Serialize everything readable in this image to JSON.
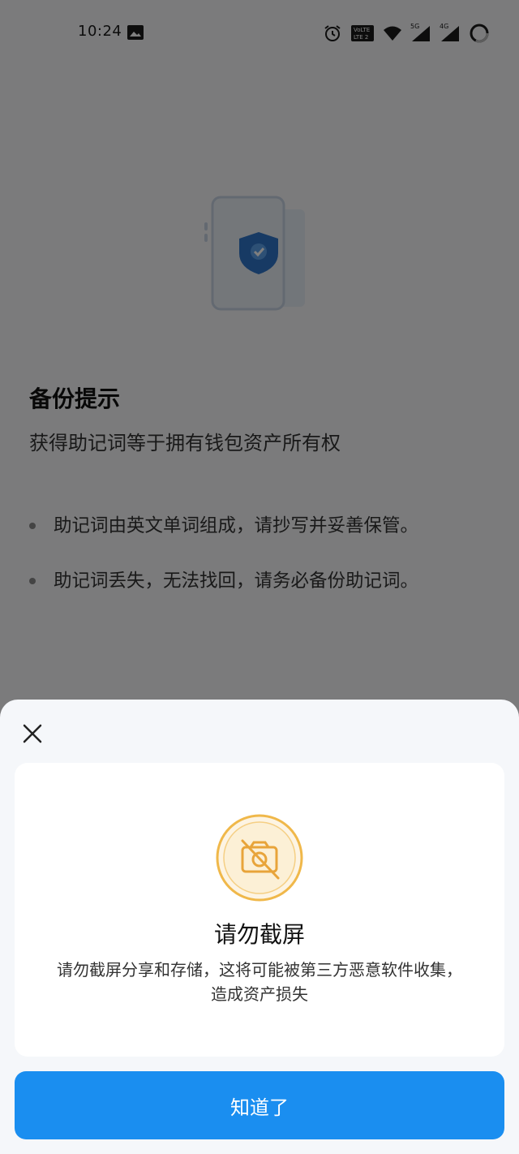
{
  "status_bar": {
    "time": "10:24",
    "icons": [
      "image-icon",
      "alarm-icon",
      "volte-lte-icon",
      "wifi-icon",
      "5g-signal-icon",
      "4g-signal-icon",
      "battery-icon"
    ],
    "network_5g": "5G",
    "network_4g": "4G"
  },
  "page": {
    "title": "备份提示",
    "subtitle": "获得助记词等于拥有钱包资产所有权",
    "bullets": [
      "助记词由英文单词组成，请抄写并妥善保管。",
      "助记词丢失，无法找回，请务必备份助记词。"
    ]
  },
  "dialog": {
    "title": "请勿截屏",
    "description": "请勿截屏分享和存储，这将可能被第三方恶意软件收集，造成资产损失",
    "confirm_label": "知道了"
  },
  "colors": {
    "accent": "#1a8ef0",
    "warning": "#f0b84a",
    "overlay": "rgba(0,0,0,0.5)"
  }
}
